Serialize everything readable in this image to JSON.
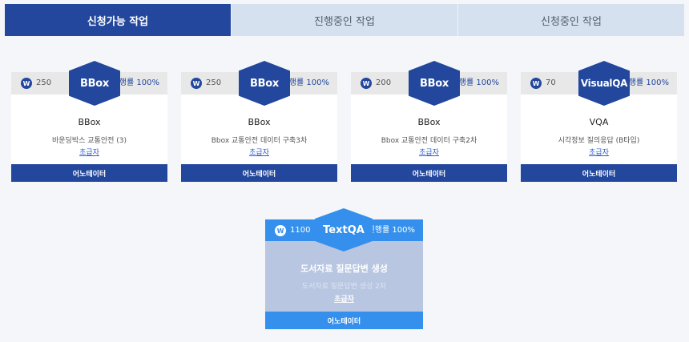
{
  "tabs": [
    {
      "label": "신청가능 작업"
    },
    {
      "label": "진행중인 작업"
    },
    {
      "label": "신청중인 작업"
    }
  ],
  "coin_symbol": "W",
  "accent_color": "#22479c",
  "featured_color": "#3490ec",
  "cards": [
    {
      "points": "250",
      "badge": "BBox",
      "progress": "진행률 100%",
      "title": "BBox",
      "desc": "바운딩박스 교통안전 (3)",
      "level": "초급자",
      "button": "어노테이터"
    },
    {
      "points": "250",
      "badge": "BBox",
      "progress": "진행률 100%",
      "title": "BBox",
      "desc": "Bbox 교통안전 데이터 구축3차",
      "level": "초급자",
      "button": "어노테이터"
    },
    {
      "points": "200",
      "badge": "BBox",
      "progress": "진행률 100%",
      "title": "BBox",
      "desc": "Bbox 교통안전 데이터 구축2차",
      "level": "초급자",
      "button": "어노테이터"
    },
    {
      "points": "70",
      "badge": "VisualQA",
      "progress": "진행률 100%",
      "title": "VQA",
      "desc": "시각정보 질의응답 (B타입)",
      "level": "초급자",
      "button": "어노테이터"
    }
  ],
  "featured": {
    "points": "1100",
    "badge": "TextQA",
    "progress": "진행률 100%",
    "title": "도서자료 질문답변 생성",
    "desc": "도서자료 질문답변 생성 2차",
    "level": "초급자",
    "button": "어노테이터"
  }
}
